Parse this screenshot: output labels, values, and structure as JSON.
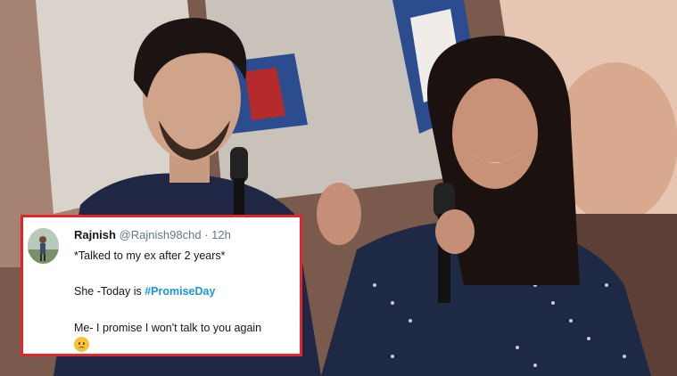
{
  "tweet": {
    "author_name": "Rajnish",
    "author_handle": "@Rajnish98chd",
    "separator": "·",
    "time": "12h",
    "line1": "*Talked to my ex after 2 years*",
    "line2_prefix": "She -Today is ",
    "hashtag": "#PromiseDay",
    "line3": "Me- I  promise I won't talk to you again",
    "emoji_name": "frowning-face-icon"
  },
  "colors": {
    "card_border": "#e0252b",
    "hashtag": "#1b95e0",
    "handle": "#657786"
  }
}
